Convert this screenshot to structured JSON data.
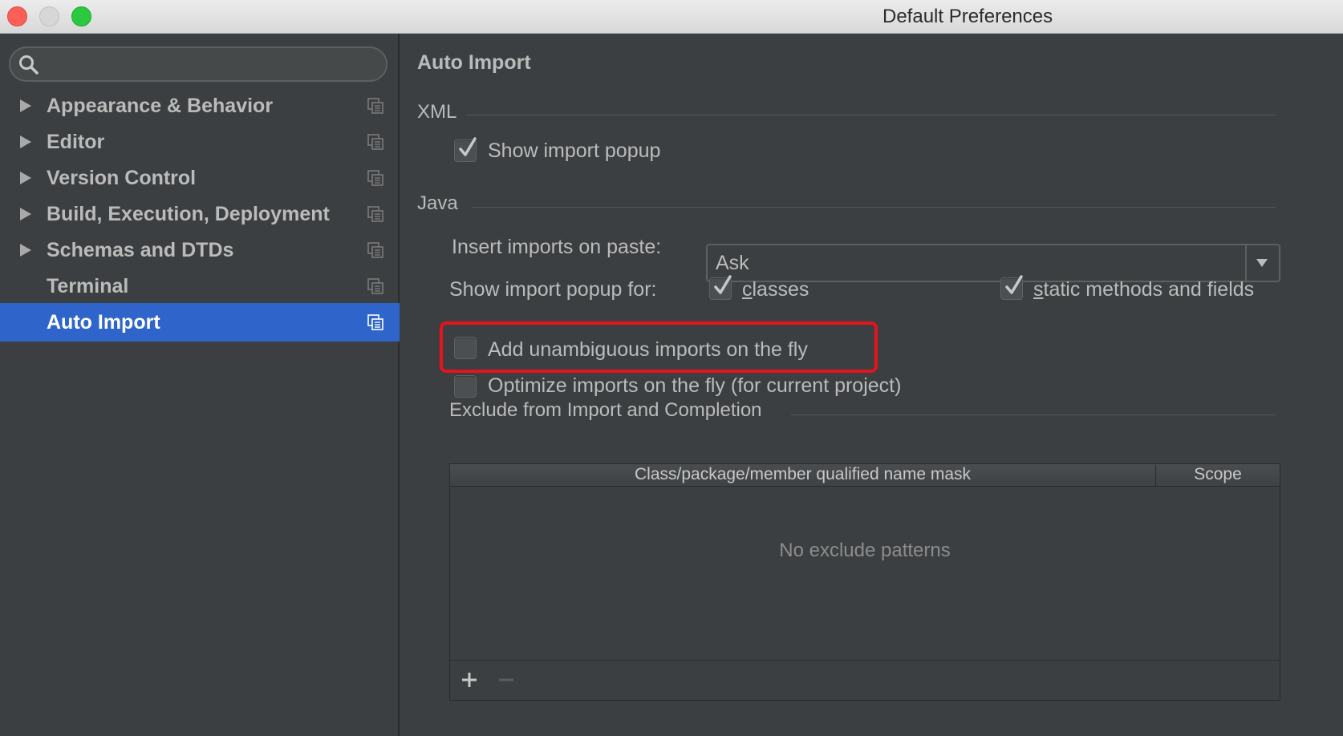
{
  "window": {
    "title": "Default Preferences"
  },
  "search": {
    "placeholder": "",
    "value": ""
  },
  "sidebar": {
    "items": [
      {
        "label": "Appearance & Behavior",
        "expandable": true,
        "selected": false
      },
      {
        "label": "Editor",
        "expandable": true,
        "selected": false
      },
      {
        "label": "Version Control",
        "expandable": true,
        "selected": false
      },
      {
        "label": "Build, Execution, Deployment",
        "expandable": true,
        "selected": false
      },
      {
        "label": "Schemas and DTDs",
        "expandable": true,
        "selected": false
      },
      {
        "label": "Terminal",
        "expandable": false,
        "selected": false
      },
      {
        "label": "Auto Import",
        "expandable": false,
        "selected": true
      }
    ],
    "selected_color": "#2f65ca"
  },
  "main": {
    "title": "Auto Import",
    "xml": {
      "section_title": "XML",
      "show_import_popup": {
        "label": "Show import popup",
        "checked": true
      }
    },
    "java": {
      "section_title": "Java",
      "insert_imports_label": "Insert imports on paste:",
      "insert_imports_value": "Ask",
      "show_popup_for_label": "Show import popup for:",
      "popup_classes": {
        "label": "classes",
        "checked": true
      },
      "popup_static": {
        "label": "static methods and fields",
        "checked": true
      },
      "add_unambiguous": {
        "label": "Add unambiguous imports on the fly",
        "checked": false
      },
      "optimize_imports": {
        "label": "Optimize imports on the fly (for current project)",
        "checked": false
      },
      "highlight_color": "#e5131d"
    },
    "exclude": {
      "section_title": "Exclude from Import and Completion",
      "columns": [
        "Class/package/member qualified name mask",
        "Scope"
      ],
      "rows": [],
      "empty_text": "No exclude patterns",
      "add_icon": "plus-icon",
      "remove_icon": "minus-icon"
    }
  }
}
